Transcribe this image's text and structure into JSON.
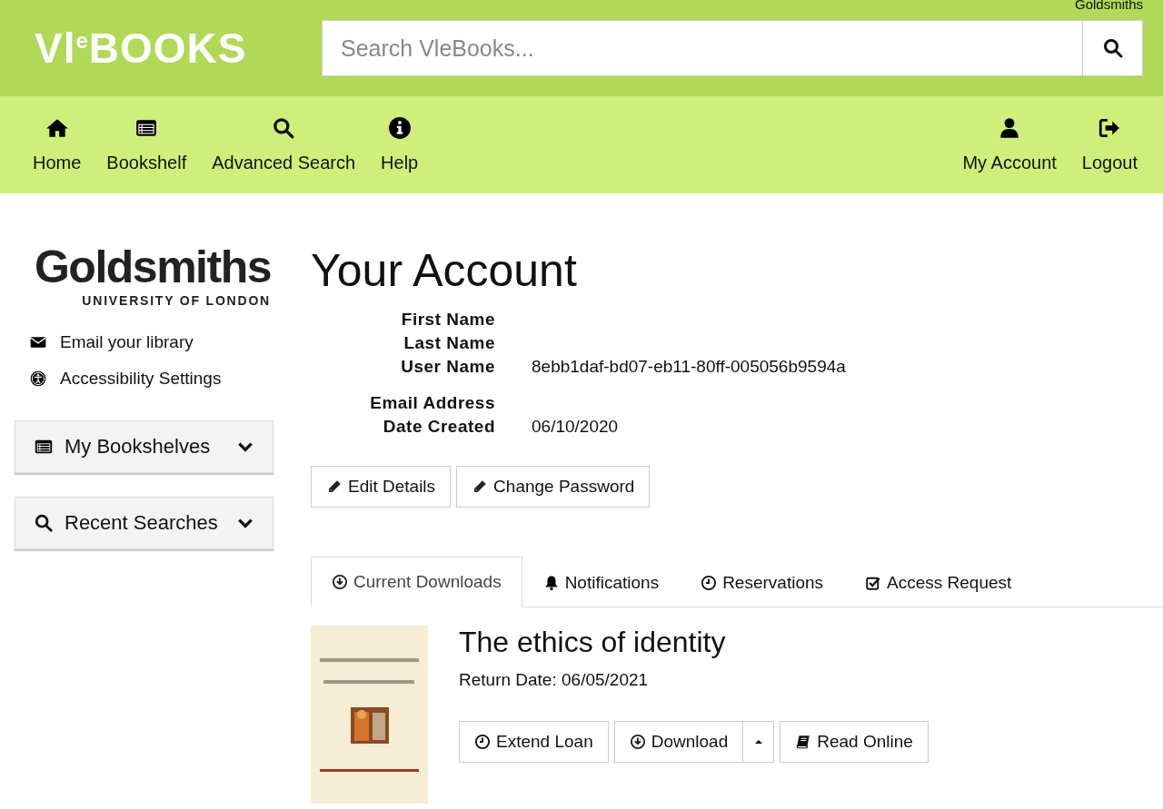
{
  "header": {
    "logo": {
      "prefix": "Vl",
      "raised": "e",
      "suffix": "BOOKS"
    },
    "institution": "Goldsmiths",
    "search": {
      "placeholder": "Search VleBooks..."
    }
  },
  "nav": {
    "left": [
      {
        "label": "Home"
      },
      {
        "label": "Bookshelf"
      },
      {
        "label": "Advanced Search"
      },
      {
        "label": "Help"
      }
    ],
    "right": [
      {
        "label": "My Account"
      },
      {
        "label": "Logout"
      }
    ]
  },
  "sidebar": {
    "logo": {
      "name": "Goldsmiths",
      "sub": "UNIVERSITY OF LONDON"
    },
    "links": [
      {
        "label": "Email your library"
      },
      {
        "label": "Accessibility Settings"
      }
    ],
    "panels": [
      {
        "label": "My Bookshelves",
        "expanded": false
      },
      {
        "label": "Recent Searches",
        "expanded": false
      }
    ]
  },
  "account": {
    "title": "Your Account",
    "fields": [
      {
        "label": "First Name"
      },
      {
        "label": "Last Name"
      },
      {
        "label": "User Name",
        "value": "8ebb1daf-bd07-eb11-80ff-005056b9594a"
      },
      {
        "label": "Email Address"
      },
      {
        "label": "Date Created",
        "value": "06/10/2020"
      }
    ],
    "buttons": [
      "Edit Details",
      "Change Password"
    ]
  },
  "tabs": [
    {
      "label": "Current Downloads",
      "selected": true
    },
    {
      "label": "Notifications",
      "selected": false
    },
    {
      "label": "Reservations",
      "selected": false
    },
    {
      "label": "Access Request",
      "selected": false
    }
  ],
  "downloads": [
    {
      "cover": {
        "kind": "picture"
      },
      "title": "The ethics of identity",
      "return_date": "Return Date: 06/05/2021",
      "actions": [
        {
          "label": "Extend Loan",
          "kind": "button"
        },
        {
          "label": "Download",
          "kind": "split"
        },
        {
          "label": "Read Online",
          "kind": "button"
        }
      ]
    }
  ]
}
